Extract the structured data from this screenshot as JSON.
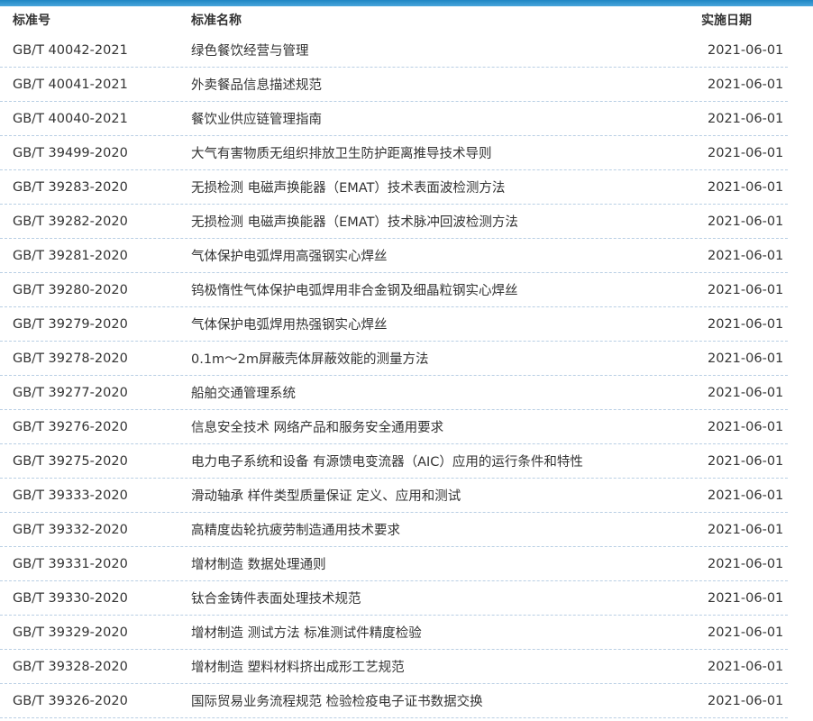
{
  "headers": {
    "code": "标准号",
    "name": "标准名称",
    "date": "实施日期"
  },
  "rows": [
    {
      "code": "GB/T 40042-2021",
      "name": "绿色餐饮经营与管理",
      "date": "2021-06-01"
    },
    {
      "code": "GB/T 40041-2021",
      "name": "外卖餐品信息描述规范",
      "date": "2021-06-01"
    },
    {
      "code": "GB/T 40040-2021",
      "name": "餐饮业供应链管理指南",
      "date": "2021-06-01"
    },
    {
      "code": "GB/T 39499-2020",
      "name": "大气有害物质无组织排放卫生防护距离推导技术导则",
      "date": "2021-06-01"
    },
    {
      "code": "GB/T 39283-2020",
      "name": "无损检测 电磁声换能器（EMAT）技术表面波检测方法",
      "date": "2021-06-01"
    },
    {
      "code": "GB/T 39282-2020",
      "name": "无损检测 电磁声换能器（EMAT）技术脉冲回波检测方法",
      "date": "2021-06-01"
    },
    {
      "code": "GB/T 39281-2020",
      "name": "气体保护电弧焊用高强钢实心焊丝",
      "date": "2021-06-01"
    },
    {
      "code": "GB/T 39280-2020",
      "name": "钨极惰性气体保护电弧焊用非合金钢及细晶粒钢实心焊丝",
      "date": "2021-06-01"
    },
    {
      "code": "GB/T 39279-2020",
      "name": "气体保护电弧焊用热强钢实心焊丝",
      "date": "2021-06-01"
    },
    {
      "code": "GB/T 39278-2020",
      "name": "0.1m～2m屏蔽壳体屏蔽效能的测量方法",
      "date": "2021-06-01"
    },
    {
      "code": "GB/T 39277-2020",
      "name": "船舶交通管理系统",
      "date": "2021-06-01"
    },
    {
      "code": "GB/T 39276-2020",
      "name": "信息安全技术 网络产品和服务安全通用要求",
      "date": "2021-06-01"
    },
    {
      "code": "GB/T 39275-2020",
      "name": "电力电子系统和设备 有源馈电变流器（AIC）应用的运行条件和特性",
      "date": "2021-06-01"
    },
    {
      "code": "GB/T 39333-2020",
      "name": "滑动轴承 样件类型质量保证 定义、应用和测试",
      "date": "2021-06-01"
    },
    {
      "code": "GB/T 39332-2020",
      "name": "高精度齿轮抗疲劳制造通用技术要求",
      "date": "2021-06-01"
    },
    {
      "code": "GB/T 39331-2020",
      "name": "增材制造 数据处理通则",
      "date": "2021-06-01"
    },
    {
      "code": "GB/T 39330-2020",
      "name": "钛合金铸件表面处理技术规范",
      "date": "2021-06-01"
    },
    {
      "code": "GB/T 39329-2020",
      "name": "增材制造 测试方法 标准测试件精度检验",
      "date": "2021-06-01"
    },
    {
      "code": "GB/T 39328-2020",
      "name": "增材制造 塑料材料挤出成形工艺规范",
      "date": "2021-06-01"
    },
    {
      "code": "GB/T 39326-2020",
      "name": "国际贸易业务流程规范 检验检疫电子证书数据交换",
      "date": "2021-06-01"
    }
  ]
}
